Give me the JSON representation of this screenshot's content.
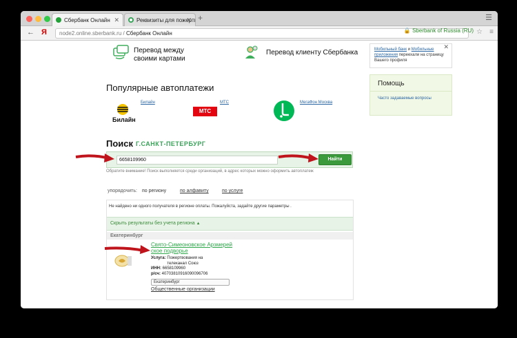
{
  "browser": {
    "tabs": [
      {
        "label": "Сбербанк Онлайн"
      },
      {
        "label": "Реквизиты для пожертвова..."
      }
    ],
    "url_host": "node2.online.sberbank.ru",
    "url_sep": " / ",
    "url_title": "Сбербанк Онлайн",
    "secure_label": "Sberbank of Russia (RU)",
    "back_icon": "arrow-left-icon",
    "browser_logo": "Я"
  },
  "transfers": {
    "between_cards": "Перевод между своими картами",
    "to_client": "Перевод клиенту Сбербанка"
  },
  "autopay": {
    "title": "Популярные автоплатежи",
    "items": [
      {
        "link": "Билайн",
        "logo_text": "Билайн"
      },
      {
        "link": "МТС",
        "logo_text": "МТС"
      },
      {
        "link": "МегаФон Москва",
        "logo_text": ""
      }
    ]
  },
  "search": {
    "title": "Поиск",
    "city": "Г.САНКТ-ПЕТЕРБУРГ",
    "value": "6658109960",
    "button": "Найти",
    "note": "Обратите внимание! Поиск выполняется среди организаций, в адрес которых можно оформить автоплатеж"
  },
  "sort": {
    "label": "упорядочить:",
    "by_region": "по региону",
    "by_alpha": "по алфавиту",
    "by_service": "по услуге"
  },
  "results": {
    "not_found": "Не найдено ни одного получателя в регионе оплаты. Пожалуйста, задайте другие параметры .",
    "hide_label": "Скрыть результаты без учета региона",
    "region": "Екатеринбург",
    "org": {
      "name": "Свято-Симеоновское Арзмерей ское подворье",
      "service_label": "Услуга:",
      "service_value": "Пожертвования на телеканал Союз",
      "inn_label": "ИНН:",
      "inn_value": "6658109960",
      "account_label": "р/сч:",
      "account_value": "40703810916090096706",
      "city_select": "Екатеринбург",
      "category": "Общественные организации"
    }
  },
  "sidebar": {
    "hint_text_1": "Мобильный банк",
    "hint_text_2": " и ",
    "hint_text_3": "Мобильные приложения",
    "hint_text_4": " переехали на страницу Вашего профиля",
    "help_title": "Помощь",
    "help_link": "Часто задаваемые вопросы"
  },
  "colors": {
    "brand_green": "#21a038",
    "button_green": "#3b9a3b",
    "arrow_red": "#c0141c"
  }
}
